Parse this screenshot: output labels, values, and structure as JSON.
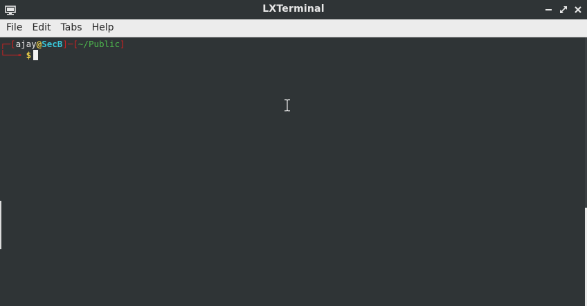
{
  "window": {
    "title": "LXTerminal",
    "icons": {
      "app": "terminal-icon",
      "minimize": "minimize-icon",
      "maximize": "maximize-icon",
      "close": "close-icon"
    }
  },
  "menubar": {
    "items": [
      {
        "label": "File"
      },
      {
        "label": "Edit"
      },
      {
        "label": "Tabs"
      },
      {
        "label": "Help"
      }
    ]
  },
  "terminal": {
    "prompt": {
      "user": "ajay",
      "at": "@",
      "host": "SecB",
      "path": "~/Public",
      "symbol": "$"
    },
    "colors": {
      "background": "#2f3436",
      "bracket": "#cc2222",
      "user": "#e6e6e6",
      "host": "#3ac6d8",
      "path": "#4eb84e",
      "symbol": "#f0d34a"
    }
  }
}
